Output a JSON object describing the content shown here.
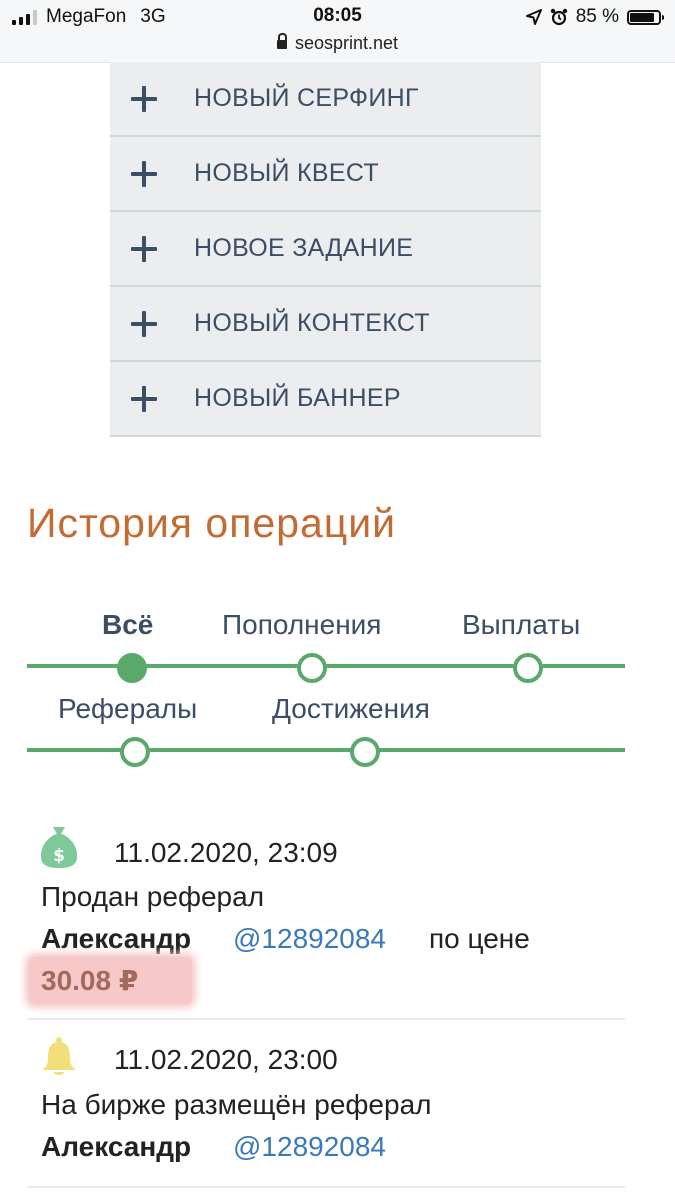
{
  "status_bar": {
    "carrier": "MegaFon",
    "network": "3G",
    "time": "08:05",
    "url": "seosprint.net",
    "battery": "85 %",
    "battery_level": 0.85
  },
  "menu": {
    "items": [
      {
        "label": "НОВЫЙ СЕРФИНГ"
      },
      {
        "label": "НОВЫЙ КВЕСТ"
      },
      {
        "label": "НОВОЕ ЗАДАНИЕ"
      },
      {
        "label": "НОВЫЙ КОНТЕКСТ"
      },
      {
        "label": "НОВЫЙ БАННЕР"
      }
    ],
    "icon": "plus-icon"
  },
  "history": {
    "title": "История операций",
    "tabs": [
      {
        "label": "Всё",
        "active": true
      },
      {
        "label": "Пополнения",
        "active": false
      },
      {
        "label": "Выплаты",
        "active": false
      },
      {
        "label": "Рефералы",
        "active": false
      },
      {
        "label": "Достижения",
        "active": false
      }
    ],
    "accent_color": "#5aa86a",
    "title_color": "#c46a33"
  },
  "entries": [
    {
      "icon": "money-bag-icon",
      "date": "11.02.2020, 23:09",
      "text": "Продан реферал",
      "user_name": "Александр",
      "user_id": "@12892084",
      "price_label": "по цене",
      "price": "30.08 ₽"
    },
    {
      "icon": "bell-icon",
      "date": "11.02.2020, 23:00",
      "text": "На бирже размещён реферал",
      "user_name": "Александр",
      "user_id": "@12892084"
    }
  ]
}
